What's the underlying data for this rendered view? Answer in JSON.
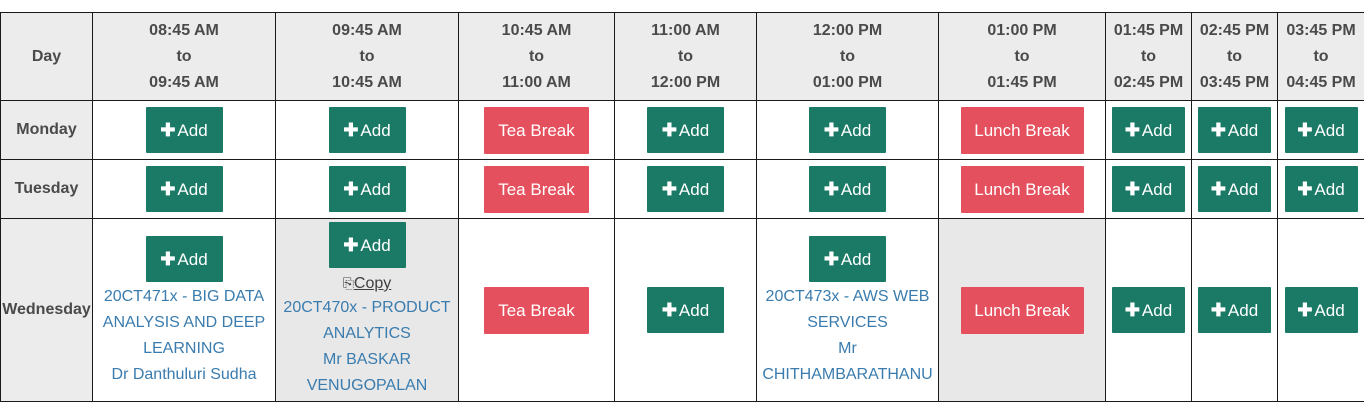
{
  "header": {
    "day": "Day",
    "slots": [
      {
        "from": "08:45 AM",
        "sep": "to",
        "to": "09:45 AM"
      },
      {
        "from": "09:45 AM",
        "sep": "to",
        "to": "10:45 AM"
      },
      {
        "from": "10:45 AM",
        "sep": "to",
        "to": "11:00 AM"
      },
      {
        "from": "11:00 AM",
        "sep": "to",
        "to": "12:00 PM"
      },
      {
        "from": "12:00 PM",
        "sep": "to",
        "to": "01:00 PM"
      },
      {
        "from": "01:00 PM",
        "sep": "to",
        "to": "01:45 PM"
      },
      {
        "from": "01:45 PM",
        "sep": "to",
        "to": "02:45 PM"
      },
      {
        "from": "02:45 PM",
        "sep": "to",
        "to": "03:45 PM"
      },
      {
        "from": "03:45 PM",
        "sep": "to",
        "to": "04:45 PM"
      }
    ]
  },
  "labels": {
    "add": "Add",
    "tea_break": "Tea Break",
    "lunch_break": "Lunch Break",
    "copy": "Copy"
  },
  "days": [
    "Monday",
    "Tuesday",
    "Wednesday"
  ],
  "wednesday": {
    "slot1": {
      "course": [
        "20CT471x - BIG DATA",
        "ANALYSIS AND DEEP",
        "LEARNING"
      ],
      "teacher": "Dr Danthuluri Sudha"
    },
    "slot2": {
      "course": [
        "20CT470x - PRODUCT",
        "ANALYTICS"
      ],
      "teacher": [
        "Mr BASKAR",
        "VENUGOPALAN"
      ]
    },
    "slot5": {
      "course": [
        "20CT473x - AWS WEB",
        "SERVICES"
      ],
      "teacher": [
        "Mr",
        "CHITHAMBARATHANU"
      ]
    }
  },
  "colors": {
    "add_button": "#1a7a66",
    "break_badge": "#e5505e",
    "course_text": "#3a7cae",
    "header_bg": "#ececec"
  },
  "icons": {
    "add": "plus-icon",
    "copy": "copy-icon"
  }
}
